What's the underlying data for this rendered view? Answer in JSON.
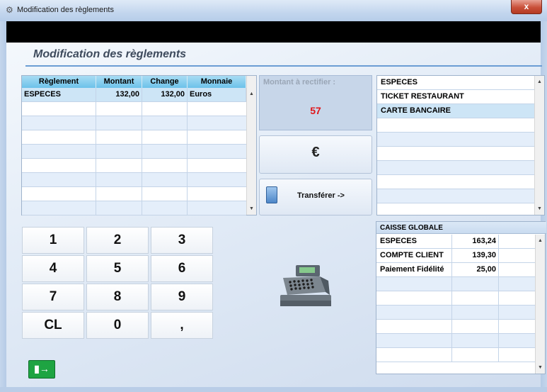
{
  "window": {
    "title": "Modification des règlements",
    "close_label": "x"
  },
  "page": {
    "title": "Modification des règlements"
  },
  "reglements_table": {
    "headers": [
      "Règlement",
      "Montant",
      "Change",
      "Monnaie"
    ],
    "rows": [
      [
        "ESPECES",
        "132,00",
        "132,00",
        "Euros"
      ]
    ]
  },
  "montant": {
    "label": "Montant à rectifier :",
    "value": "57"
  },
  "currency_button": {
    "label": "€"
  },
  "transfer_button": {
    "label": "Transférer ->"
  },
  "payment_types": {
    "items": [
      "ESPECES",
      "TICKET RESTAURANT",
      "CARTE BANCAIRE"
    ],
    "selected_index": 2
  },
  "keypad": {
    "keys": [
      "1",
      "2",
      "3",
      "4",
      "5",
      "6",
      "7",
      "8",
      "9",
      "CL",
      "0",
      ","
    ]
  },
  "caisse": {
    "title": "CAISSE GLOBALE",
    "rows": [
      [
        "ESPECES",
        "163,24"
      ],
      [
        "COMPTE CLIENT",
        "139,30"
      ],
      [
        "Paiement Fidélité",
        "25,00"
      ]
    ]
  },
  "icons": {
    "title": "app-icon",
    "calc": "calculator-icon",
    "register": "cash-register-icon",
    "exit": "exit-icon"
  },
  "colors": {
    "header_blue": "#6cc2ea",
    "montant_red": "#e0161a",
    "exit_green": "#1ea442",
    "accent_line": "#6b9dd4"
  }
}
